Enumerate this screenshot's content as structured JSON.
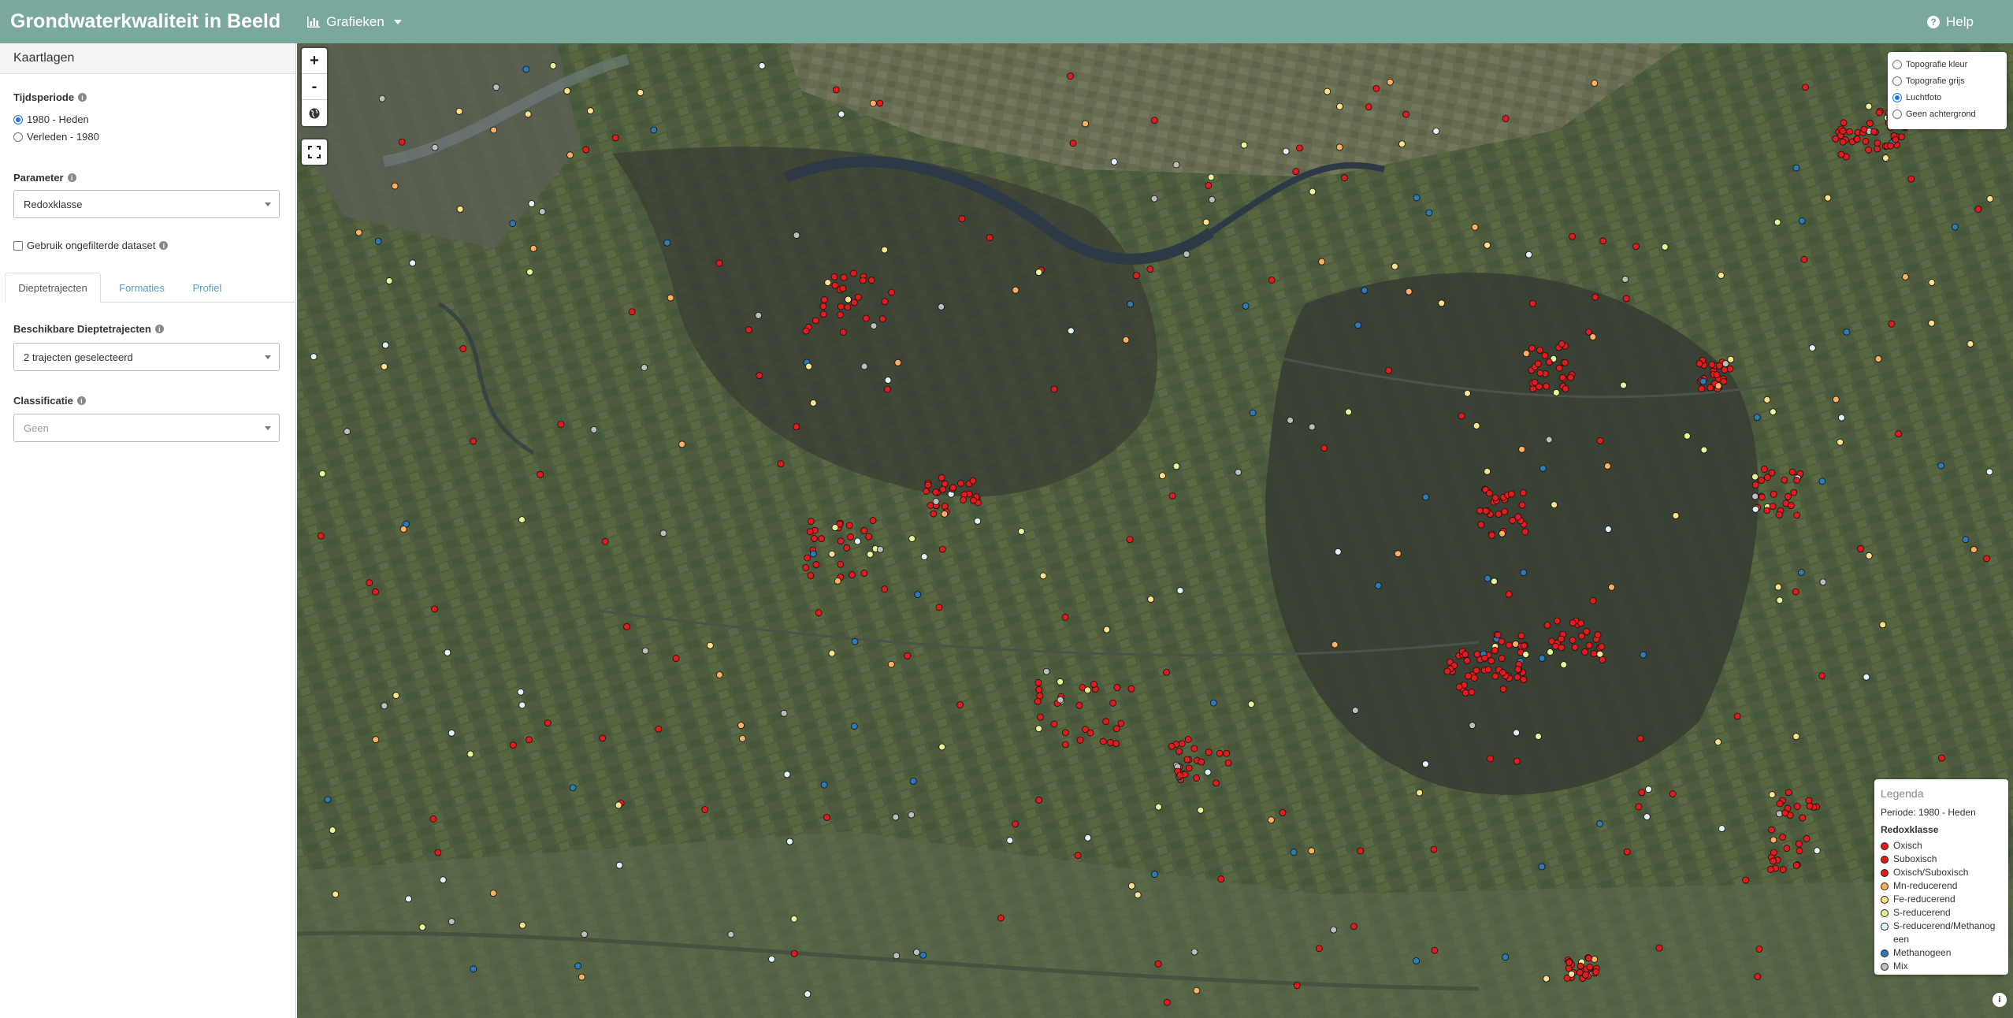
{
  "app": {
    "title": "Grondwaterkwaliteit in Beeld"
  },
  "navbar": {
    "menu_label": "Grafieken",
    "help_label": "Help"
  },
  "sidebar": {
    "panel_title": "Kaartlagen",
    "period": {
      "label": "Tijdsperiode",
      "options": [
        "1980 - Heden",
        "Verleden - 1980"
      ],
      "selected": "1980 - Heden"
    },
    "parameter": {
      "label": "Parameter",
      "value": "Redoxklasse"
    },
    "unfiltered": {
      "label": "Gebruik ongefilterde dataset",
      "checked": false
    },
    "tabs": [
      "Dieptetrajecten",
      "Formaties",
      "Profiel"
    ],
    "active_tab": "Dieptetrajecten",
    "depth": {
      "label": "Beschikbare Dieptetrajecten",
      "value": "2 trajecten geselecteerd"
    },
    "classification": {
      "label": "Classificatie",
      "value": "Geen"
    }
  },
  "map": {
    "zoom_in": "+",
    "zoom_out": "-",
    "basemaps": [
      "Topografie kleur",
      "Topografie grijs",
      "Luchtfoto",
      "Geen achtergrond"
    ],
    "selected_basemap": "Luchtfoto",
    "legend": {
      "title": "Legenda",
      "period": "Periode: 1980 - Heden",
      "parameter": "Redoxklasse",
      "items": [
        {
          "label": "Oxisch",
          "color": "#e41a1c"
        },
        {
          "label": "Suboxisch",
          "color": "#e41a1c"
        },
        {
          "label": "Oxisch/Suboxisch",
          "color": "#e41a1c"
        },
        {
          "label": "Mn-reducerend",
          "color": "#fdae61"
        },
        {
          "label": "Fe-reducerend",
          "color": "#fee08b"
        },
        {
          "label": "S-reducerend",
          "color": "#e6f598"
        },
        {
          "label": "S-reducerend/Methanogeen",
          "color": "#e0f3f8"
        },
        {
          "label": "Methanogeen",
          "color": "#2c7bb6"
        },
        {
          "label": "Mix",
          "color": "#bdbdbd"
        }
      ]
    },
    "attribution_icon": "info-icon"
  },
  "colors": {
    "navbar": "#7aa89c",
    "link": "#5a9bc7"
  }
}
